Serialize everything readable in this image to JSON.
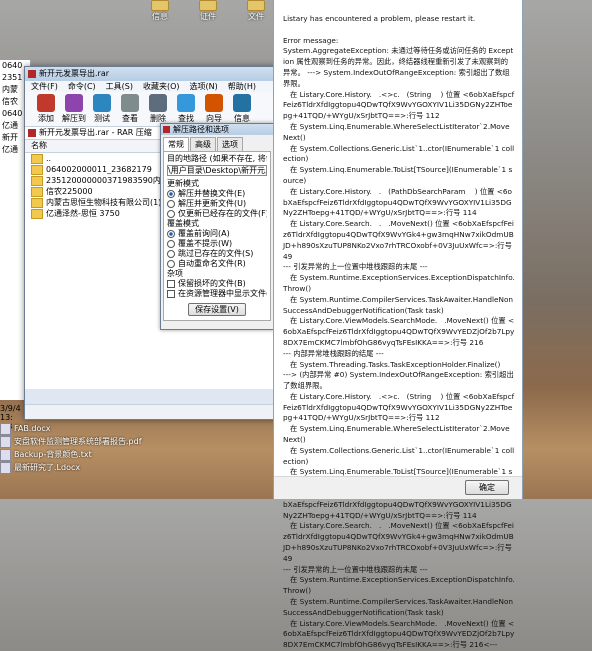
{
  "desktop": {
    "top_icons": [
      "信息",
      "证件",
      "文件"
    ],
    "left_explorer": [
      "0640",
      "2351",
      "内蒙",
      "信农",
      "0640",
      "亿通",
      "新开",
      "亿通",
      "",
      "",
      "",
      "",
      "",
      "",
      "",
      "",
      "",
      "",
      "",
      "",
      "",
      "",
      "",
      "",
      "3/9/4 13:",
      "MB"
    ],
    "files": [
      "FAB.docx",
      "安盘软件监测管理系统部署报告.pdf",
      "Backup-背景颜色.txt",
      "最新研究了.Ldocx"
    ]
  },
  "rar": {
    "title": "新开元发票导出.rar",
    "menu": [
      "文件(F)",
      "命令(C)",
      "工具(S)",
      "收藏夹(O)",
      "选项(N)",
      "帮助(H)"
    ],
    "toolbar": [
      "添加",
      "解压到",
      "测试",
      "查看",
      "删除",
      "查找",
      "向导",
      "信息"
    ],
    "address": "新开元发票导出.rar - RAR 压缩",
    "column_header": "名称",
    "rows": [
      "..",
      "064002000011_23682179",
      "2351200000003719835​90内蒙古思恒生物...",
      "信农225000",
      "内蒙古思恒生物科技有限公司(1)",
      "亿通泽然-思恒 3750"
    ]
  },
  "options": {
    "title": "解压路径和选项",
    "tabs": [
      "常规",
      "高级",
      "选项"
    ],
    "target_label": "目的地路径 (如果不存在, 将创建) (P)",
    "target_value": "\\用户目录\\Desktop\\新开元发票导出",
    "update_mode_label": "更新模式",
    "update_modes": [
      "解压并替换文件(E)",
      "解压并更新文件(U)",
      "仅更新已经存在的文件(F)"
    ],
    "overwrite_label": "覆盖模式",
    "overwrite_modes": [
      "覆盖前询问(A)",
      "覆盖不提示(W)",
      "跳过已存在的文件(S)",
      "自动重命名文件(R)"
    ],
    "misc_label": "杂项",
    "misc_checks": [
      "保留损坏的文件(B)",
      "在资源管理器中显示文件(X)"
    ],
    "save_button": "保存设置(V)"
  },
  "error": {
    "message": "Listary has encountered a problem, please restart it.\n\nError message:\nSystem.AggregateException: 未通过等待任务或访问任务的 Exception 属性观察到任务的异常。因此，终结器线程重新引发了未观察到的异常。 ---> System.IndexOutOfRangeException: 索引超出了数组界限。\n   在 Listary.Core.History.   .<>c.   (String    ) 位置 <6obXaEfspcfFeiz6TldrXfdIggtopu4QDwTQfX9WvYGOXYIV1Li35DGNy2ZHToepg+41TQD/+WYgU/xSrJbtTQ==>:行号 112\n   在 System.Linq.Enumerable.WhereSelectListIterator`2.MoveNext()\n   在 System.Collections.Generic.List`1..ctor(IEnumerable`1 collection)\n   在 System.Linq.Enumerable.ToList[TSource](IEnumerable`1 source)\n   在 Listary.Core.History.   .   (PathDbSearchParam    ) 位置 <6obXaEfspcfFeiz6TldrXfdIggtopu4QDwTQfX9WvYGOXYIV1Li35DGNy2ZHToepg+41TQD/+WYgU/xSrJbtTQ==>:行号 114\n   在 Listary.Core.Search.   .   .MoveNext() 位置 <6obXaEfspcfFeiz6TldrXfdIggtopu4QDwTQfX9WvYGk4+gw3mqHNw7xikOdmUBJD+h890sXzuTUP8NKo2Vxo7rhTRCOxobf+0V3JuUxWfc=>:行号 49\n--- 引发异常的上一位置中堆栈跟踪的末尾 ---\n   在 System.Runtime.ExceptionServices.ExceptionDispatchInfo.Throw()\n   在 System.Runtime.CompilerServices.TaskAwaiter.HandleNonSuccessAndDebuggerNotification(Task task)\n   在 Listary.Core.ViewModels.SearchMode.   .MoveNext() 位置 <6obXaEfspcfFeiz6TldrXfdIggtopu4QDwTQfX9WvYEDZjOf2b7Lpy8DX7EmCKMC7lmbfOhG86vyqTsFEsIKKA==>:行号 216\n--- 内部异常堆栈跟踪的结尾 ---\n   在 System.Threading.Tasks.TaskExceptionHolder.Finalize()\n---> (内部异常 #0) System.IndexOutOfRangeException: 索引超出了数组界限。\n   在 Listary.Core.History.   .<>c.   (String    ) 位置 <6obXaEfspcfFeiz6TldrXfdIggtopu4QDwTQfX9WvYGOXYIV1Li35DGNy2ZHToepg+41TQD/+WYgU/xSrJbtTQ==>:行号 112\n   在 System.Linq.Enumerable.WhereSelectListIterator`2.MoveNext()\n   在 System.Collections.Generic.List`1..ctor(IEnumerable`1 collection)\n   在 System.Linq.Enumerable.ToList[TSource](IEnumerable`1 source)\n   在 Listary.Core.History.   .   (PathDbSearchParam    ) 位置 <6obXaEfspcfFeiz6TldrXfdIggtopu4QDwTQfX9WvYGOXYIV1Li35DGNy2ZHToepg+41TQD/+WYgU/xSrJbtTQ==>:行号 114\n   在 Listary.Core.Search.   .   .MoveNext() 位置 <6obXaEfspcfFeiz6TldrXfdIggtopu4QDwTQfX9WvYGk4+gw3mqHNw7xikOdmUBJD+h890sXzuTUP8NKo2Vxo7rhTRCOxobf+0V3JuUxWfc=>:行号 49\n--- 引发异常的上一位置中堆栈跟踪的末尾 ---\n   在 System.Runtime.ExceptionServices.ExceptionDispatchInfo.Throw()\n   在 System.Runtime.CompilerServices.TaskAwaiter.HandleNonSuccessAndDebuggerNotification(Task task)\n   在 Listary.Core.ViewModels.SearchMode.   .MoveNext() 位置 <6obXaEfspcfFeiz6TldrXfdIggtopu4QDwTQfX9WvYEDZjOf2b7Lpy8DX7EmCKMC7lmbfOhG86vyqTsFEsIKKA==>:行号 216<---",
    "ok_label": "确定"
  },
  "colors": {
    "error_bg": "#ffffff",
    "folder": "#f0c94e",
    "rar_red": "#b02828",
    "selection": "#cfe3fb"
  }
}
